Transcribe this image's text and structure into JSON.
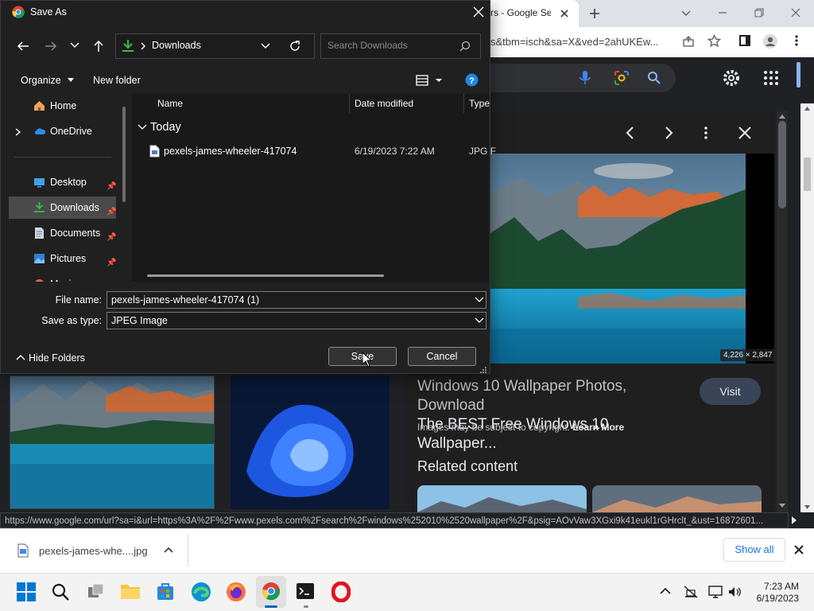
{
  "browser": {
    "tab_title": "rs - Google Se",
    "url": "s&tbm=isch&sa=X&ved=2ahUKEw...",
    "status_url": "https://www.google.com/url?sa=i&url=https%3A%2F%2Fwww.pexels.com%2Fsearch%2Fwindows%252010%2520wallpaper%2F&psig=AOvVaw3XGxi9k41eukl1rGHrclt_&ust=16872601..."
  },
  "viewer": {
    "dimensions": "4,226 × 2,847",
    "title_main": "Windows 10 Wallpaper Photos, Download",
    "title_rest": "The BEST Free Windows 10 Wallpaper...",
    "copyright": "Images may be subject to copyright.",
    "learn_more": "Learn More",
    "visit": "Visit",
    "related": "Related content"
  },
  "dialog": {
    "title": "Save As",
    "address": "Downloads",
    "search_placeholder": "Search Downloads",
    "organize": "Organize",
    "new_folder": "New folder",
    "nav": [
      {
        "label": "Home"
      },
      {
        "label": "OneDrive"
      },
      {
        "label": "Desktop"
      },
      {
        "label": "Downloads"
      },
      {
        "label": "Documents"
      },
      {
        "label": "Pictures"
      },
      {
        "label": "Music"
      }
    ],
    "columns": {
      "name": "Name",
      "date": "Date modified",
      "type": "Type"
    },
    "group": "Today",
    "file": {
      "name": "pexels-james-wheeler-417074",
      "date": "6/19/2023 7:22 AM",
      "type": "JPG F"
    },
    "file_name_label": "File name:",
    "file_name_value": "pexels-james-wheeler-417074 (1)",
    "save_type_label": "Save as type:",
    "save_type_value": "JPEG Image",
    "hide_folders": "Hide Folders",
    "save": "Save",
    "cancel": "Cancel"
  },
  "download": {
    "file": "pexels-james-whe....jpg",
    "show_all": "Show all"
  },
  "taskbar": {
    "time": "7:23 AM",
    "date": "6/19/2023"
  },
  "colors": {
    "accent": "#1a73e8",
    "selection": "#4a4a4a",
    "dialog_bg": "#202020"
  }
}
